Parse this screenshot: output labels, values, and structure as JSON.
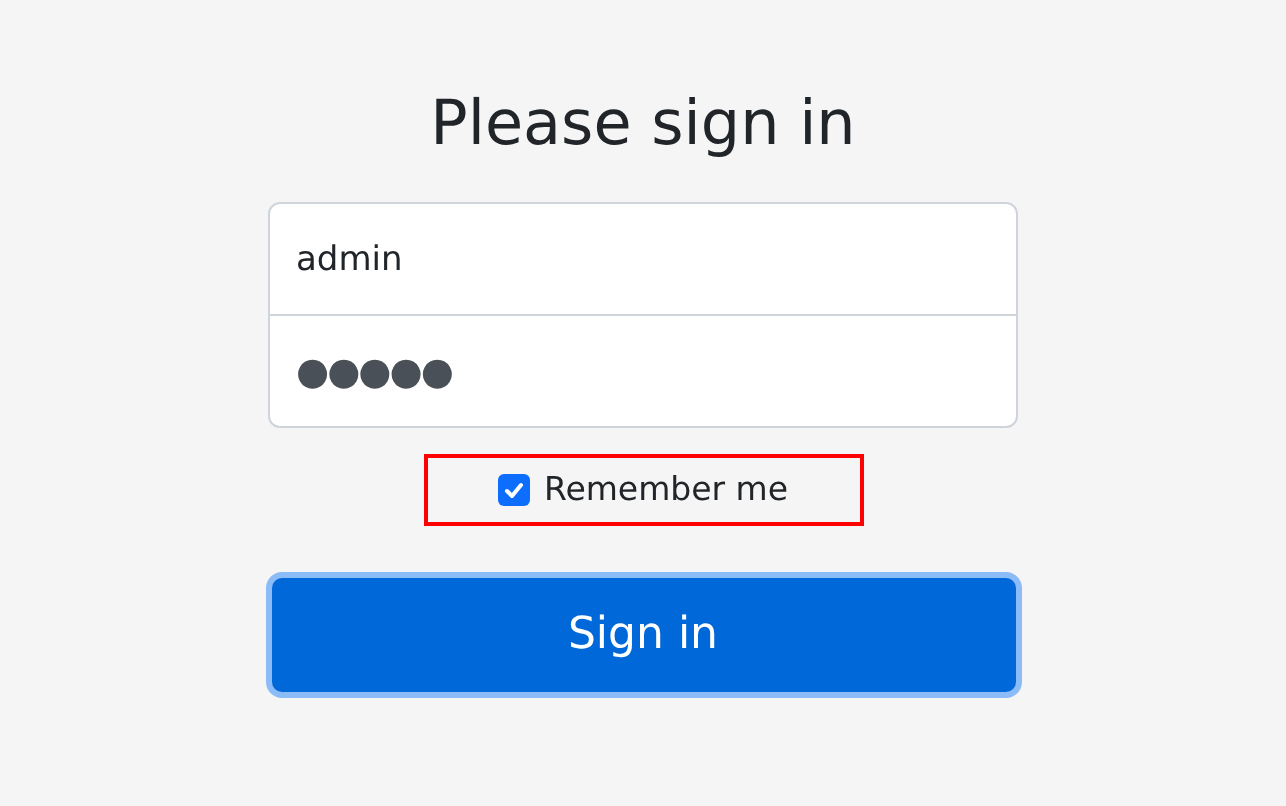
{
  "title": "Please sign in",
  "username": {
    "value": "admin"
  },
  "password": {
    "value": "●●●●●"
  },
  "remember": {
    "label": "Remember me",
    "checked": true,
    "highlighted": true
  },
  "submit": {
    "label": "Sign in",
    "focused": true
  }
}
